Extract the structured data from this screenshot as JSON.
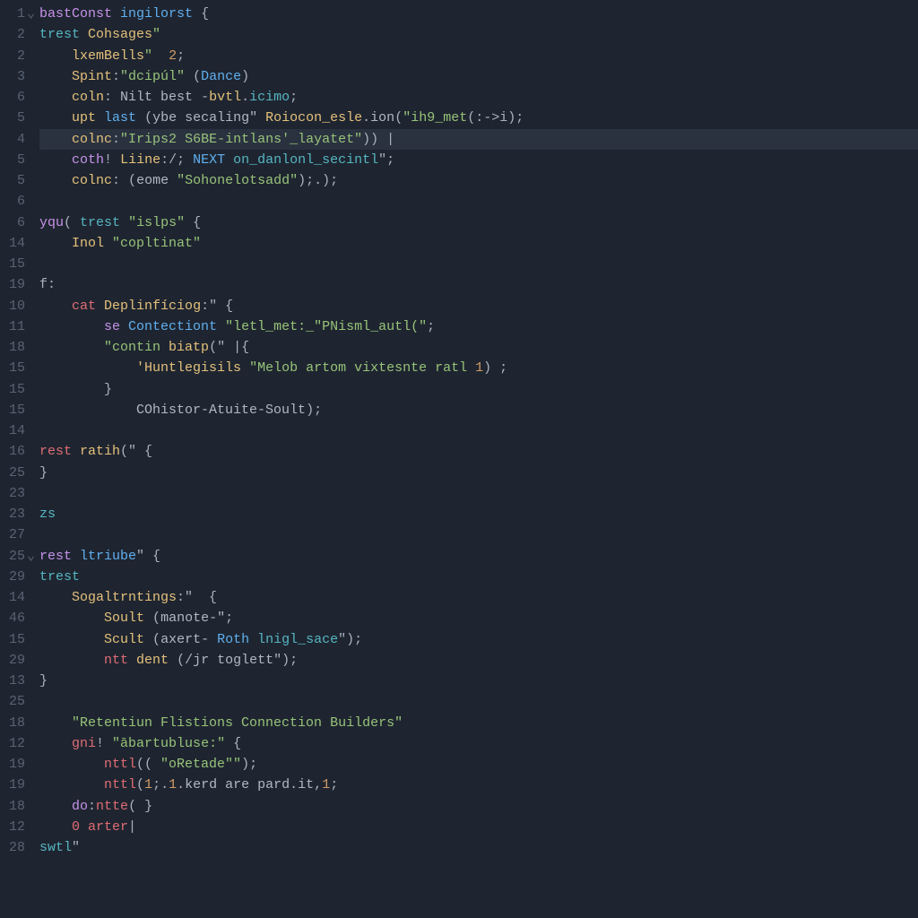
{
  "colors": {
    "bg": "#1e2530",
    "fg": "#b0b8c4",
    "gutter": "#5a6374",
    "highlight_line_bg": "#2a3240",
    "purple": "#c792ea",
    "red": "#e06c75",
    "blue": "#61afef",
    "teal": "#56b6c2",
    "yellow": "#e5c07b",
    "green": "#98c379",
    "orange": "#d19a66"
  },
  "highlighted_line_index": 6,
  "lines": [
    {
      "num": "1",
      "indent": 0,
      "fold": "v",
      "tokens": [
        [
          "keyword",
          "bastConst"
        ],
        [
          "plain",
          " "
        ],
        [
          "def",
          "ingilorst"
        ],
        [
          "plain",
          " "
        ],
        [
          "punct",
          "{"
        ]
      ]
    },
    {
      "num": "2",
      "indent": 0,
      "tokens": [
        [
          "teal",
          "trest"
        ],
        [
          "plain",
          " "
        ],
        [
          "fn",
          "Cohsages"
        ],
        [
          "string",
          "\""
        ]
      ]
    },
    {
      "num": "2",
      "indent": 1,
      "tokens": [
        [
          "fn",
          "lxemBells"
        ],
        [
          "string",
          "\""
        ],
        [
          "plain",
          "  "
        ],
        [
          "number",
          "2"
        ],
        [
          "punct",
          ";"
        ]
      ]
    },
    {
      "num": "3",
      "indent": 1,
      "tokens": [
        [
          "fn",
          "Spint"
        ],
        [
          "punct",
          ":"
        ],
        [
          "string",
          "\"dcipúl\""
        ],
        [
          "plain",
          " "
        ],
        [
          "punct",
          "("
        ],
        [
          "def",
          "Dance"
        ],
        [
          "punct",
          ")"
        ]
      ]
    },
    {
      "num": "6",
      "indent": 1,
      "tokens": [
        [
          "fn",
          "coln"
        ],
        [
          "punct",
          ": "
        ],
        [
          "plain",
          "Nilt best "
        ],
        [
          "punct",
          "-"
        ],
        [
          "fn",
          "bvtl"
        ],
        [
          "punct",
          "."
        ],
        [
          "teal",
          "icimo"
        ],
        [
          "punct",
          ";"
        ]
      ]
    },
    {
      "num": "5",
      "indent": 1,
      "tokens": [
        [
          "fn",
          "upt"
        ],
        [
          "plain",
          " "
        ],
        [
          "def",
          "last"
        ],
        [
          "plain",
          " "
        ],
        [
          "punct",
          "("
        ],
        [
          "plain",
          "ybe secaling\" "
        ],
        [
          "fn",
          "Roiocon_esle"
        ],
        [
          "punct",
          "."
        ],
        [
          "plain",
          "ion"
        ],
        [
          "punct",
          "("
        ],
        [
          "string",
          "\"ih9_met"
        ],
        [
          "punct",
          "(:->i);"
        ]
      ]
    },
    {
      "num": "4",
      "indent": 1,
      "hl": true,
      "tokens": [
        [
          "fn",
          "colnc"
        ],
        [
          "punct",
          ":"
        ],
        [
          "string",
          "\"Irips2"
        ],
        [
          "plain",
          " "
        ],
        [
          "string",
          "S6BE-intlans'_layatet\""
        ],
        [
          "punct",
          "))"
        ],
        [
          "plain",
          " "
        ],
        [
          "punct",
          "|"
        ]
      ]
    },
    {
      "num": "5",
      "indent": 1,
      "tokens": [
        [
          "keyword",
          "coth"
        ],
        [
          "punct",
          "!"
        ],
        [
          "plain",
          " "
        ],
        [
          "fn",
          "Liine"
        ],
        [
          "punct",
          ":/; "
        ],
        [
          "def",
          "NEXT"
        ],
        [
          "plain",
          " "
        ],
        [
          "teal",
          "on_danlonl_secintl"
        ],
        [
          "punct",
          "\";"
        ]
      ]
    },
    {
      "num": "5",
      "indent": 1,
      "tokens": [
        [
          "fn",
          "colnc"
        ],
        [
          "punct",
          ": "
        ],
        [
          "punct",
          "("
        ],
        [
          "plain",
          "eome "
        ],
        [
          "string",
          "\"Sohonelotsadd\""
        ],
        [
          "punct",
          ");.);"
        ]
      ]
    },
    {
      "num": "6",
      "indent": 0,
      "tokens": []
    },
    {
      "num": "6",
      "indent": 0,
      "tokens": [
        [
          "keyword",
          "yqu"
        ],
        [
          "punct",
          "( "
        ],
        [
          "teal",
          "trest"
        ],
        [
          "plain",
          " "
        ],
        [
          "string",
          "\"islps\""
        ],
        [
          "plain",
          " "
        ],
        [
          "punct",
          "{"
        ]
      ]
    },
    {
      "num": "14",
      "indent": 1,
      "tokens": [
        [
          "fn",
          "Inol"
        ],
        [
          "plain",
          " "
        ],
        [
          "string",
          "\"copltinat\""
        ]
      ]
    },
    {
      "num": "15",
      "indent": 0,
      "tokens": []
    },
    {
      "num": "19",
      "indent": 0,
      "tokens": [
        [
          "punct",
          "f:"
        ]
      ]
    },
    {
      "num": "10",
      "indent": 1,
      "tokens": [
        [
          "keyword2",
          "cat"
        ],
        [
          "plain",
          " "
        ],
        [
          "fn",
          "Deplinfíciog"
        ],
        [
          "punct",
          ":\" {"
        ]
      ]
    },
    {
      "num": "11",
      "indent": 2,
      "tokens": [
        [
          "keyword",
          "se"
        ],
        [
          "plain",
          " "
        ],
        [
          "def",
          "Contectiont"
        ],
        [
          "plain",
          " "
        ],
        [
          "string",
          "\"letl_met:_\"PNisml_autl(\""
        ],
        [
          "punct",
          ";"
        ]
      ]
    },
    {
      "num": "18",
      "indent": 2,
      "tokens": [
        [
          "string",
          "\"contin"
        ],
        [
          "plain",
          " "
        ],
        [
          "fn",
          "biatp"
        ],
        [
          "punct",
          "(\" |{"
        ]
      ]
    },
    {
      "num": "15",
      "indent": 3,
      "tokens": [
        [
          "fn",
          "'Huntlegisils"
        ],
        [
          "plain",
          " "
        ],
        [
          "string",
          "\"Melob artom vixtesnte ratl"
        ],
        [
          "plain",
          " "
        ],
        [
          "number",
          "1"
        ],
        [
          "punct",
          ") ;"
        ]
      ]
    },
    {
      "num": "15",
      "indent": 2,
      "tokens": [
        [
          "punct",
          "}"
        ]
      ]
    },
    {
      "num": "15",
      "indent": 3,
      "tokens": [
        [
          "plain",
          "COhistor-Atuite-Soult"
        ],
        [
          "punct",
          ");"
        ]
      ]
    },
    {
      "num": "14",
      "indent": 0,
      "tokens": []
    },
    {
      "num": "16",
      "indent": 0,
      "tokens": [
        [
          "keyword2",
          "rest"
        ],
        [
          "plain",
          " "
        ],
        [
          "fn",
          "ratih"
        ],
        [
          "punct",
          "(\" {"
        ]
      ]
    },
    {
      "num": "25",
      "indent": 0,
      "tokens": [
        [
          "punct",
          "}"
        ]
      ]
    },
    {
      "num": "23",
      "indent": 0,
      "tokens": []
    },
    {
      "num": "23",
      "indent": 0,
      "tokens": [
        [
          "teal",
          "zs"
        ]
      ]
    },
    {
      "num": "27",
      "indent": 0,
      "tokens": []
    },
    {
      "num": "25",
      "indent": 0,
      "fold": "v",
      "tokens": [
        [
          "keyword",
          "rest"
        ],
        [
          "plain",
          " "
        ],
        [
          "def",
          "ltriube"
        ],
        [
          "punct",
          "\" {"
        ]
      ]
    },
    {
      "num": "29",
      "indent": 0,
      "tokens": [
        [
          "teal",
          "trest"
        ]
      ]
    },
    {
      "num": "14",
      "indent": 1,
      "tokens": [
        [
          "fn",
          "Sogaltrntings"
        ],
        [
          "punct",
          ":\"  {"
        ]
      ]
    },
    {
      "num": "46",
      "indent": 2,
      "tokens": [
        [
          "fn",
          "Soult"
        ],
        [
          "plain",
          " "
        ],
        [
          "punct",
          "("
        ],
        [
          "plain",
          "manote-\""
        ],
        [
          "punct",
          ";"
        ]
      ]
    },
    {
      "num": "15",
      "indent": 2,
      "tokens": [
        [
          "fn",
          "Scult"
        ],
        [
          "plain",
          " "
        ],
        [
          "punct",
          "("
        ],
        [
          "plain",
          "axert- "
        ],
        [
          "def",
          "Roth"
        ],
        [
          "plain",
          " "
        ],
        [
          "teal",
          "lnigl_sace"
        ],
        [
          "punct",
          "\");"
        ]
      ]
    },
    {
      "num": "29",
      "indent": 2,
      "tokens": [
        [
          "keyword2",
          "ntt"
        ],
        [
          "plain",
          " "
        ],
        [
          "fn",
          "dent"
        ],
        [
          "plain",
          " "
        ],
        [
          "punct",
          "(/"
        ],
        [
          "plain",
          "jr toglett"
        ],
        [
          "punct",
          "\");"
        ]
      ]
    },
    {
      "num": "13",
      "indent": 0,
      "tokens": [
        [
          "punct",
          "}"
        ]
      ]
    },
    {
      "num": "25",
      "indent": 0,
      "tokens": []
    },
    {
      "num": "18",
      "indent": 1,
      "tokens": [
        [
          "string",
          "\"Retentiun Flistions Connection Builders\""
        ]
      ]
    },
    {
      "num": "12",
      "indent": 1,
      "tokens": [
        [
          "keyword2",
          "gni"
        ],
        [
          "punct",
          "! "
        ],
        [
          "string",
          "\"ābartubluse:\""
        ],
        [
          "plain",
          " "
        ],
        [
          "punct",
          "{"
        ]
      ]
    },
    {
      "num": "19",
      "indent": 2,
      "tokens": [
        [
          "keyword2",
          "nttl"
        ],
        [
          "punct",
          "(( "
        ],
        [
          "string",
          "\"oRetade\"\""
        ],
        [
          "punct",
          ");"
        ]
      ]
    },
    {
      "num": "19",
      "indent": 2,
      "tokens": [
        [
          "keyword2",
          "nttl"
        ],
        [
          "punct",
          "("
        ],
        [
          "number",
          "1"
        ],
        [
          "punct",
          ";."
        ],
        [
          "number",
          "1"
        ],
        [
          "punct",
          "."
        ],
        [
          "plain",
          "kerd are pard"
        ],
        [
          "punct",
          "."
        ],
        [
          "plain",
          "it"
        ],
        [
          "punct",
          ","
        ],
        [
          "number",
          "1"
        ],
        [
          "punct",
          ";"
        ]
      ]
    },
    {
      "num": "18",
      "indent": 1,
      "tokens": [
        [
          "keyword",
          "do"
        ],
        [
          "punct",
          ":"
        ],
        [
          "keyword2",
          "ntte"
        ],
        [
          "punct",
          "( }"
        ]
      ]
    },
    {
      "num": "12",
      "indent": 1,
      "tokens": [
        [
          "keyword2",
          "0 arter"
        ],
        [
          "punct",
          "|"
        ]
      ]
    },
    {
      "num": "28",
      "indent": 0,
      "tokens": [
        [
          "teal",
          "swtl"
        ],
        [
          "punct",
          "\""
        ]
      ]
    }
  ]
}
